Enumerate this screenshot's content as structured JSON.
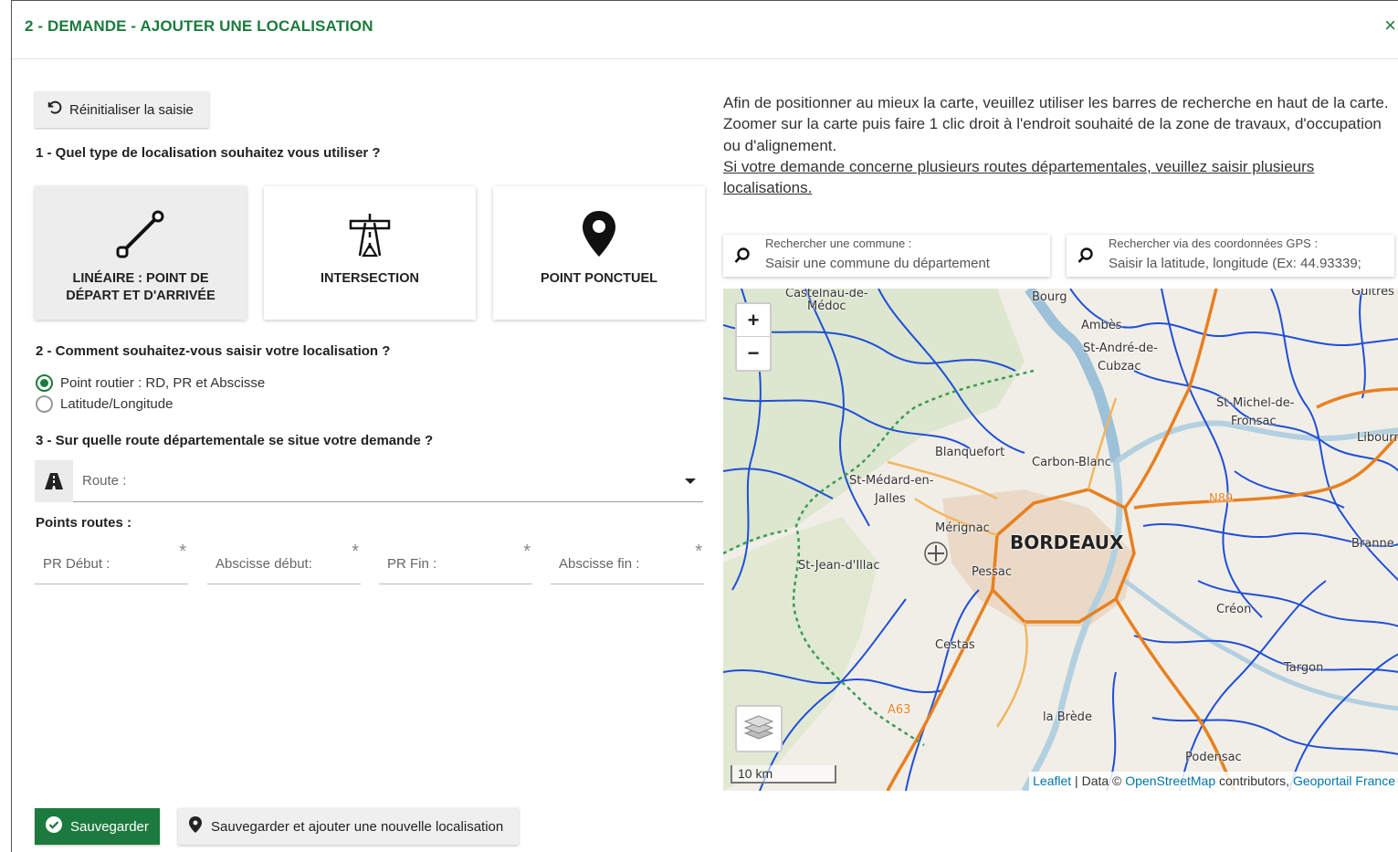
{
  "header": {
    "title": "2 - DEMANDE - AJOUTER UNE LOCALISATION",
    "close": "×"
  },
  "form": {
    "reset_label": "Réinitialiser la saisie",
    "q1": "1 - Quel type de localisation souhaitez vous utiliser ?",
    "types": [
      {
        "label": "LINÉAIRE : POINT DE DÉPART ET D'ARRIVÉE",
        "icon": "line-segment-icon",
        "active": true
      },
      {
        "label": "INTERSECTION",
        "icon": "highway-intersection-icon",
        "active": false
      },
      {
        "label": "POINT PONCTUEL",
        "icon": "map-marker-icon",
        "active": false
      }
    ],
    "q2": "2 - Comment souhaitez-vous saisir votre localisation ?",
    "radio_options": [
      {
        "label": "Point routier : RD, PR et Abscisse",
        "checked": true
      },
      {
        "label": "Latitude/Longitude",
        "checked": false
      }
    ],
    "q3": "3 - Sur quelle route départementale se situe votre demande ?",
    "route_label": "Route :",
    "points_title": "Points routes :",
    "points": [
      {
        "placeholder": "PR Début :",
        "required": "*"
      },
      {
        "placeholder": "Abscisse début:",
        "required": "*"
      },
      {
        "placeholder": "PR Fin :",
        "required": "*"
      },
      {
        "placeholder": "Abscisse fin :",
        "required": "*"
      }
    ],
    "save_label": "Sauvegarder",
    "save_add_label": "Sauvegarder et ajouter une nouvelle localisation"
  },
  "info": {
    "line1": "Afin de positionner au mieux la carte, veuillez utiliser les barres de recherche en haut de la carte.",
    "line2": "Zoomer sur la carte puis faire 1 clic droit à l'endroit souhaité de la zone de travaux, d'occupation ou d'alignement.",
    "line3": "Si votre demande concerne plusieurs routes départementales, veuillez saisir plusieurs localisations."
  },
  "search_commune": {
    "label": "Rechercher une commune :",
    "value": "Saisir une commune du département"
  },
  "search_gps": {
    "label": "Rechercher via des coordonnées GPS :",
    "value": "Saisir la latitude, longitude (Ex: 44.93339;"
  },
  "map": {
    "zoom_in": "+",
    "zoom_out": "−",
    "scale": "10 km",
    "attribution_leaflet": "Leaflet",
    "attribution_mid": " | Data © ",
    "attribution_osm": "OpenStreetMap",
    "attribution_contrib": " contributors, ",
    "attribution_geo": "Geoportail France",
    "labels": {
      "castelnau": "Castelnau-de-",
      "medoc": "Médoc",
      "bourg": "Bourg",
      "ambes": "Ambès",
      "st_andre": "St-André-de-",
      "cubzac": "Cubzac",
      "guitres": "Guîtres",
      "st_michel": "St-Michel-de-",
      "fronsac": "Fronsac",
      "libourne": "Libourne",
      "blanquefort": "Blanquefort",
      "carbon_blanc": "Carbon-Blanc",
      "st_medard": "St-Médard-en-",
      "jalles": "Jalles",
      "merignac": "Mérignac",
      "bordeaux": "BORDEAUX",
      "st_jean": "St-Jean-d'Illac",
      "pessac": "Pessac",
      "branne": "Branne",
      "creon": "Créon",
      "cestas": "Cestas",
      "a63": "A63",
      "n89": "N89",
      "targon": "Targon",
      "la_brede": "la Brède",
      "podensac": "Podensac"
    }
  },
  "colors": {
    "accent": "#1d7a3e",
    "road_blue": "#1f4fd6",
    "road_orange": "#e8801f",
    "water": "#b9d3e0"
  }
}
